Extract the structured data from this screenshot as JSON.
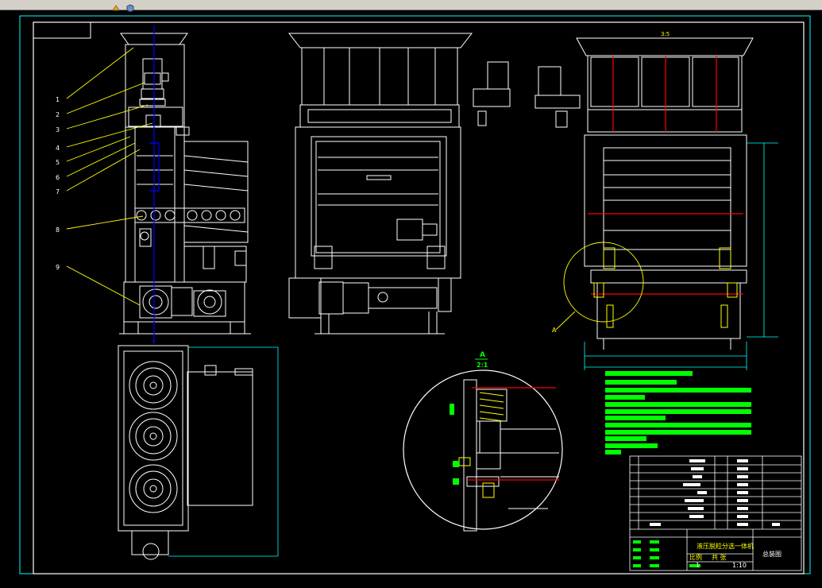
{
  "toolbar": {
    "icons": [
      "paint-bucket-icon",
      "cube-icon"
    ]
  },
  "drawing": {
    "part_numbers": [
      "1",
      "2",
      "3",
      "4",
      "5",
      "6",
      "7",
      "8",
      "9"
    ],
    "section_marker": "A",
    "detail_scale": "2:1",
    "dimension_marker": "3:5",
    "title_block": {
      "title": "液压脱粒分选一体机",
      "scale_label": "比例",
      "sheet_label": "共 张",
      "right_label": "总装图",
      "qty": "1",
      "scale": "1:10"
    }
  },
  "colors": {
    "background": "#000000",
    "outline": "#ffffff",
    "leader": "#ffff00",
    "center": "#0000ff",
    "dim": "#00ffff",
    "note": "#00ff00",
    "hatch": "#ff0000"
  }
}
